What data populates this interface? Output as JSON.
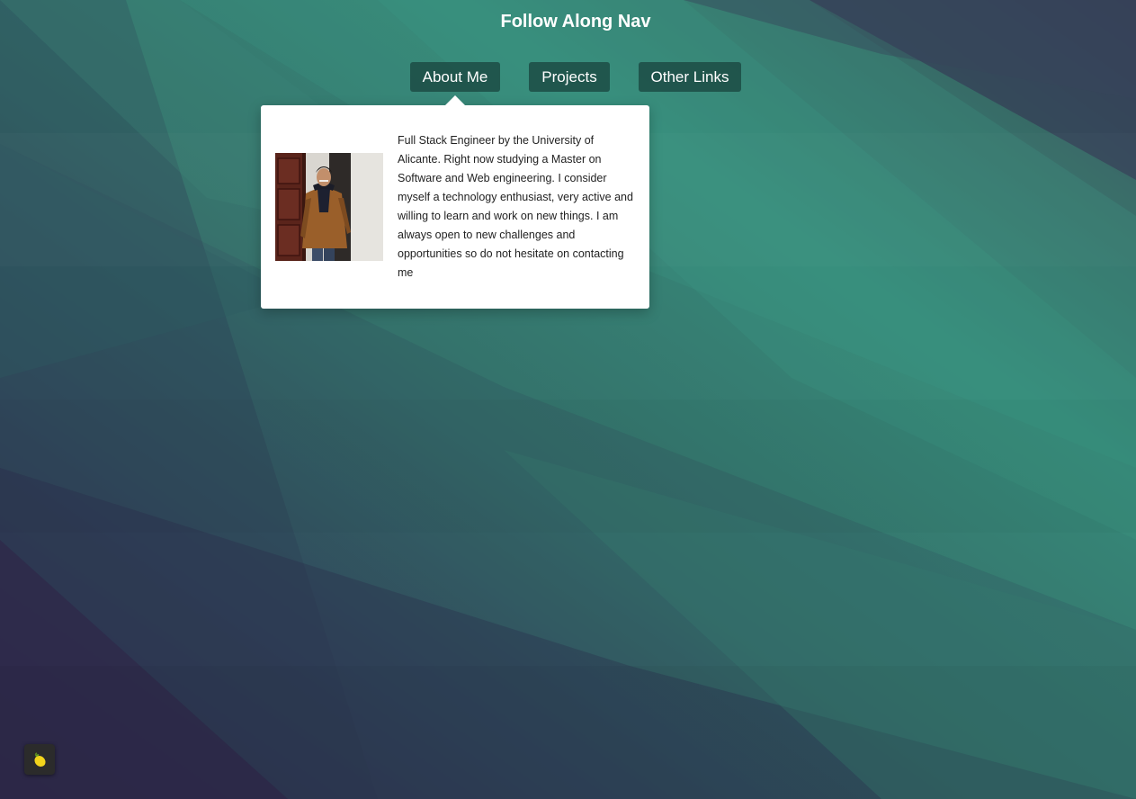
{
  "page": {
    "title": "Follow Along Nav"
  },
  "nav": {
    "items": [
      {
        "label": "About Me"
      },
      {
        "label": "Projects"
      },
      {
        "label": "Other Links"
      }
    ]
  },
  "dropdown": {
    "open_tab": "About Me",
    "bio": "Full Stack Engineer by the University of Alicante. Right now studying a Master on Software and Web engineering. I consider myself a technology enthusiast, very active and willing to learn and work on new things. I am always open to new challenges and opportunities so do not hesitate on contacting me",
    "photo_icon": "profile-photo"
  },
  "floating_button": {
    "icon": "lemon-icon"
  },
  "colors": {
    "background_teal": "#37776b",
    "background_purple": "#33264a",
    "nav_button_bg": "#1f4a44",
    "dropdown_bg": "#ffffff",
    "text_white": "#ffffff",
    "lemon_yellow": "#f2d41c"
  }
}
